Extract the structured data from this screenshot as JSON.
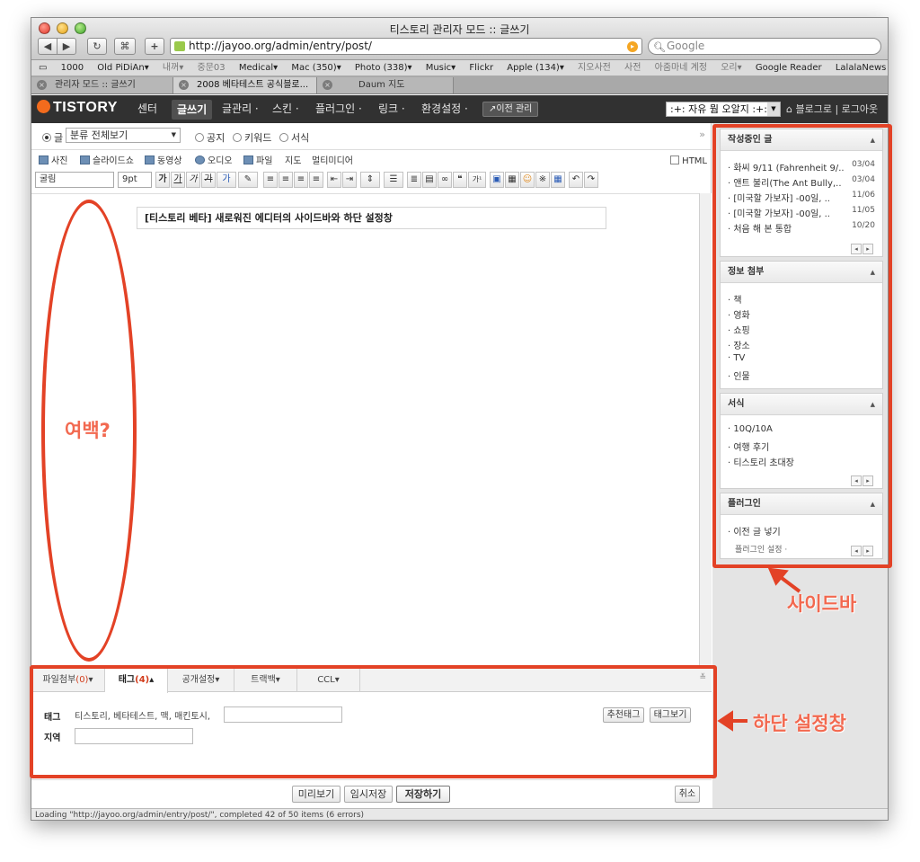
{
  "window": {
    "title": "티스토리 관리자 모드 :: 글쓰기"
  },
  "browser": {
    "url": "http://jayoo.org/admin/entry/post/",
    "search_placeholder": "Google",
    "bookmarks": [
      "1000",
      "Old PiDiAn▾",
      "내꺼▾",
      "중문03",
      "Medical▾",
      "Mac (350)▾",
      "Photo (338)▾",
      "Music▾",
      "Flickr",
      "Apple (134)▾",
      "지오사전",
      "사전",
      "아줌마네 계정",
      "오리▾",
      "Google Reader",
      "LalalaNews"
    ],
    "tabs": [
      {
        "label": "관리자 모드 :: 글쓰기"
      },
      {
        "label": "2008 베타테스트 공식블로..."
      },
      {
        "label": "Daum 지도"
      }
    ]
  },
  "tistory": {
    "logo": "TISTORY",
    "menu": [
      "센터",
      "글쓰기",
      "글관리 ·",
      "스킨 ·",
      "플러그인 ·",
      "링크 ·",
      "환경설정 ·"
    ],
    "prev_admin": "↗이전 관리",
    "blog_select": ":+: 자유 뭠 오알지 :+:",
    "header_links": "⌂ 블로그로 | 로그아웃"
  },
  "editor": {
    "type_options": [
      "글",
      "공지",
      "키워드",
      "서식"
    ],
    "category": "분류 전체보기",
    "media_buttons": [
      "사진",
      "슬라이드쇼",
      "동영상",
      "오디오",
      "파일",
      "지도",
      "멀티미디어"
    ],
    "html_label": "HTML",
    "font_family": "굴림",
    "font_size": "9pt",
    "format_glyphs": [
      "가",
      "가",
      "가",
      "가",
      "가",
      "≡",
      "≡",
      "≡",
      "≡",
      "⇤",
      "⇥",
      "⇕",
      "☰",
      "≣",
      "▤",
      "∞",
      "❝",
      "가¹",
      "▣",
      "▦",
      "☺",
      "※",
      "▦",
      "↶",
      "↷"
    ],
    "title": "[티스토리 베타] 새로워진 에디터의 사이드바와 하단 설정창"
  },
  "sidebar": {
    "sections": [
      {
        "title": "작성중인 글",
        "items": [
          {
            "label": "· 화씨 9/11 (Fahrenheit 9/..",
            "date": "03/04"
          },
          {
            "label": "· 앤트 불리(The Ant Bully,..",
            "date": "03/04"
          },
          {
            "label": "· [미국할 가보자] -00일, ..",
            "date": "11/06"
          },
          {
            "label": "· [미국할 가보자] -00일, ..",
            "date": "11/05"
          },
          {
            "label": "· 처음 해 본 통합",
            "date": "10/20"
          }
        ]
      },
      {
        "title": "정보 첨부",
        "items": [
          {
            "label": "· 책"
          },
          {
            "label": "· 영화"
          },
          {
            "label": "· 쇼핑"
          },
          {
            "label": "· 장소"
          },
          {
            "label": "· TV"
          },
          {
            "label": "· 인물"
          }
        ]
      },
      {
        "title": "서식",
        "items": [
          {
            "label": "· 10Q/10A"
          },
          {
            "label": "· 여행 후기"
          },
          {
            "label": "· 티스토리 초대장"
          }
        ]
      },
      {
        "title": "플러그인",
        "items": [
          {
            "label": "· 이전 글 넣기"
          },
          {
            "label": "플러그인 설정 ·"
          }
        ]
      }
    ]
  },
  "bottom": {
    "tabs": [
      {
        "label": "파일첨부",
        "count": "(0)",
        "arrow": "▾"
      },
      {
        "label": "태그",
        "count": "(4)",
        "arrow": "▴"
      },
      {
        "label": "공개설정",
        "count": "",
        "arrow": "▾"
      },
      {
        "label": "트랙백",
        "count": "",
        "arrow": "▾"
      },
      {
        "label": "CCL",
        "count": "",
        "arrow": "▾"
      }
    ],
    "tag_label": "태그",
    "tag_value": "티스토리, 베타테스트, 맥, 매킨토시,",
    "region_label": "지역",
    "recommend_tags": "추천태그",
    "tag_view": "태그보기"
  },
  "actions": {
    "preview": "미리보기",
    "temp_save": "임시저장",
    "save": "저장하기",
    "cancel": "취소"
  },
  "status": "Loading \"http://jayoo.org/admin/entry/post/\", completed 42 of 50 items (6 errors)",
  "annotations": {
    "margin": "여백?",
    "sidebar": "사이드바",
    "bottom": "하단 설정창",
    "color": "#e34226"
  }
}
